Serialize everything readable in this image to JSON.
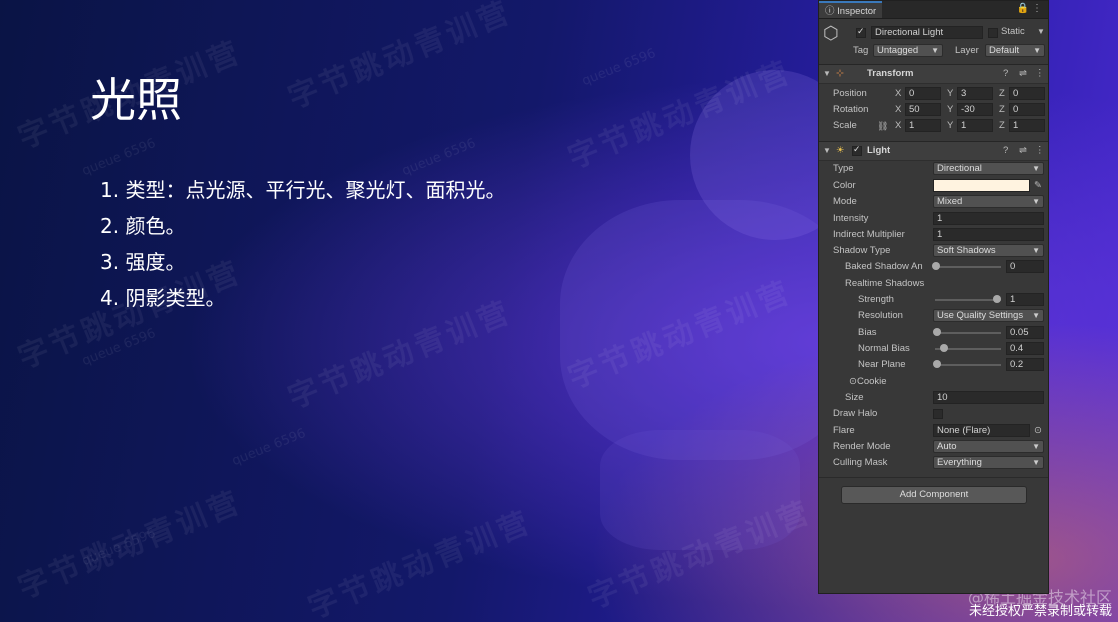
{
  "slide": {
    "title": "光照",
    "points": [
      "1. 类型：点光源、平行光、聚光灯、面积光。",
      "2. 颜色。",
      "3. 强度。",
      "4. 阴影类型。"
    ],
    "watermark_main": "字节跳动青训营",
    "watermark_small": "queue 6596",
    "footer_note": "未经授权严禁录制或转载",
    "juejin_mark": "@稀土掘金技术社区"
  },
  "inspector": {
    "tab": "Inspector",
    "object": {
      "active": true,
      "name": "Directional Light",
      "static_label": "Static",
      "tag_label": "Tag",
      "tag": "Untagged",
      "layer_label": "Layer",
      "layer": "Default"
    },
    "transform": {
      "title": "Transform",
      "position_label": "Position",
      "rotation_label": "Rotation",
      "scale_label": "Scale",
      "position": {
        "x": "0",
        "y": "3",
        "z": "0"
      },
      "rotation": {
        "x": "50",
        "y": "-30",
        "z": "0"
      },
      "scale": {
        "x": "1",
        "y": "1",
        "z": "1"
      }
    },
    "light": {
      "title": "Light",
      "enabled": true,
      "fields": {
        "type_label": "Type",
        "type": "Directional",
        "color_label": "Color",
        "color": "#fff3e0",
        "mode_label": "Mode",
        "mode": "Mixed",
        "intensity_label": "Intensity",
        "intensity": "1",
        "indirect_label": "Indirect Multiplier",
        "indirect": "1",
        "shadow_type_label": "Shadow Type",
        "shadow_type": "Soft Shadows",
        "baked_label": "Baked Shadow An",
        "baked": "0",
        "realtime_label": "Realtime Shadows",
        "strength_label": "Strength",
        "strength": "1",
        "resolution_label": "Resolution",
        "resolution": "Use Quality Settings",
        "bias_label": "Bias",
        "bias": "0.05",
        "normal_bias_label": "Normal Bias",
        "normal_bias": "0.4",
        "near_plane_label": "Near Plane",
        "near_plane": "0.2",
        "cookie_label": "Cookie",
        "size_label": "Size",
        "size": "10",
        "draw_halo_label": "Draw Halo",
        "flare_label": "Flare",
        "flare": "None (Flare)",
        "render_mode_label": "Render Mode",
        "render_mode": "Auto",
        "culling_label": "Culling Mask",
        "culling": "Everything"
      }
    },
    "add_component": "Add Component"
  },
  "colors": {
    "accent": "#3a79bb",
    "panel": "#383838",
    "field": "#2a2a2a"
  }
}
